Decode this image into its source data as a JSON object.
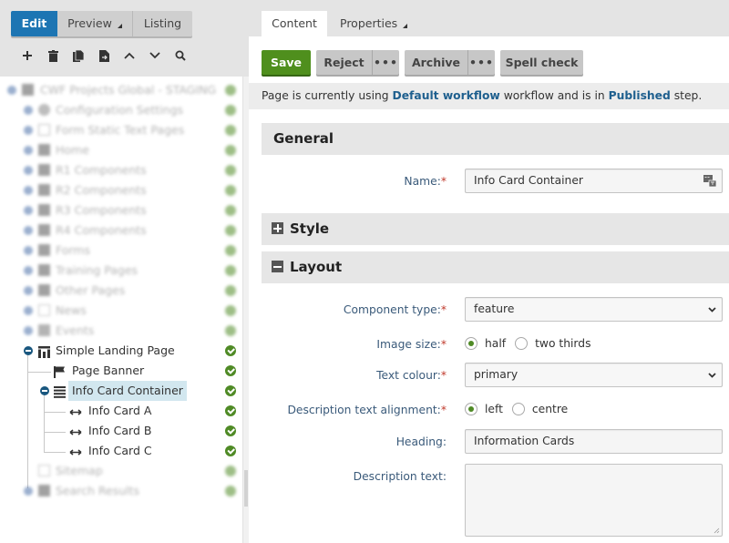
{
  "left": {
    "mode_tabs": [
      {
        "label": "Edit",
        "active": true
      },
      {
        "label": "Preview",
        "active": false,
        "has_menu": true
      },
      {
        "label": "Listing",
        "active": false
      }
    ],
    "tree_tools": [
      "add-icon",
      "delete-icon",
      "copy-icon",
      "move-icon",
      "move-up-icon",
      "move-down-icon",
      "search-icon"
    ],
    "tree": [
      {
        "label": "CWF Projects Global - STAGING",
        "blurred": true,
        "status": "published"
      },
      {
        "label": "Configuration Settings",
        "blurred": true,
        "status": "published"
      },
      {
        "label": "Form Static Text Pages",
        "blurred": true,
        "status": "published"
      },
      {
        "label": "Home",
        "blurred": true,
        "status": "published"
      },
      {
        "label": "R1 Components",
        "blurred": true,
        "status": "published"
      },
      {
        "label": "R2 Components",
        "blurred": true,
        "status": "published"
      },
      {
        "label": "R3 Components",
        "blurred": true,
        "status": "published"
      },
      {
        "label": "R4 Components",
        "blurred": true,
        "status": "published"
      },
      {
        "label": "Forms",
        "blurred": true,
        "status": "published"
      },
      {
        "label": "Training Pages",
        "blurred": true,
        "status": "published"
      },
      {
        "label": "Other Pages",
        "blurred": true,
        "status": "published"
      },
      {
        "label": "News",
        "blurred": true,
        "status": "published"
      },
      {
        "label": "Events",
        "blurred": true,
        "status": "published"
      },
      {
        "label": "Simple Landing Page",
        "blurred": false,
        "status": "published"
      },
      {
        "label": "Page Banner",
        "blurred": false,
        "status": "published"
      },
      {
        "label": "Info Card Container",
        "blurred": false,
        "status": "published",
        "selected": true
      },
      {
        "label": "Info Card A",
        "blurred": false,
        "status": "published"
      },
      {
        "label": "Info Card B",
        "blurred": false,
        "status": "published"
      },
      {
        "label": "Info Card C",
        "blurred": false,
        "status": "published"
      },
      {
        "label": "Sitemap",
        "blurred": true,
        "status": "published"
      },
      {
        "label": "Search Results",
        "blurred": true,
        "status": "published"
      }
    ]
  },
  "right": {
    "tabs": [
      {
        "label": "Content",
        "active": true
      },
      {
        "label": "Properties",
        "active": false,
        "has_menu": true
      }
    ],
    "actions": {
      "save": "Save",
      "reject": "Reject",
      "archive": "Archive",
      "more": "•••",
      "spell_check": "Spell check"
    },
    "workflow_info": {
      "prefix": "Page is currently using ",
      "workflow": "Default workflow",
      "middle": " workflow and is in ",
      "step": "Published",
      "suffix": " step."
    },
    "sections": {
      "general": "General",
      "style": "Style",
      "layout": "Layout"
    },
    "fields": {
      "name": {
        "label": "Name:",
        "required": "*",
        "value": "Info Card Container"
      },
      "component_type": {
        "label": "Component type:",
        "required": "*",
        "value": "feature"
      },
      "image_size": {
        "label": "Image size:",
        "required": "*",
        "options": [
          "half",
          "two thirds"
        ],
        "selected": "half"
      },
      "text_colour": {
        "label": "Text colour:",
        "required": "*",
        "value": "primary"
      },
      "description_alignment": {
        "label": "Description text alignment:",
        "required": "*",
        "options": [
          "left",
          "centre"
        ],
        "selected": "left"
      },
      "heading": {
        "label": "Heading:",
        "value": "Information Cards"
      },
      "description_text": {
        "label": "Description text:",
        "value": ""
      }
    }
  },
  "colors": {
    "accent_blue": "#1d75b3",
    "save_green": "#4f8f1d",
    "status_green": "#4f8a25",
    "link_blue": "#1e5f8e",
    "label_blue": "#3a5a7a",
    "required_red": "#c0392b"
  }
}
